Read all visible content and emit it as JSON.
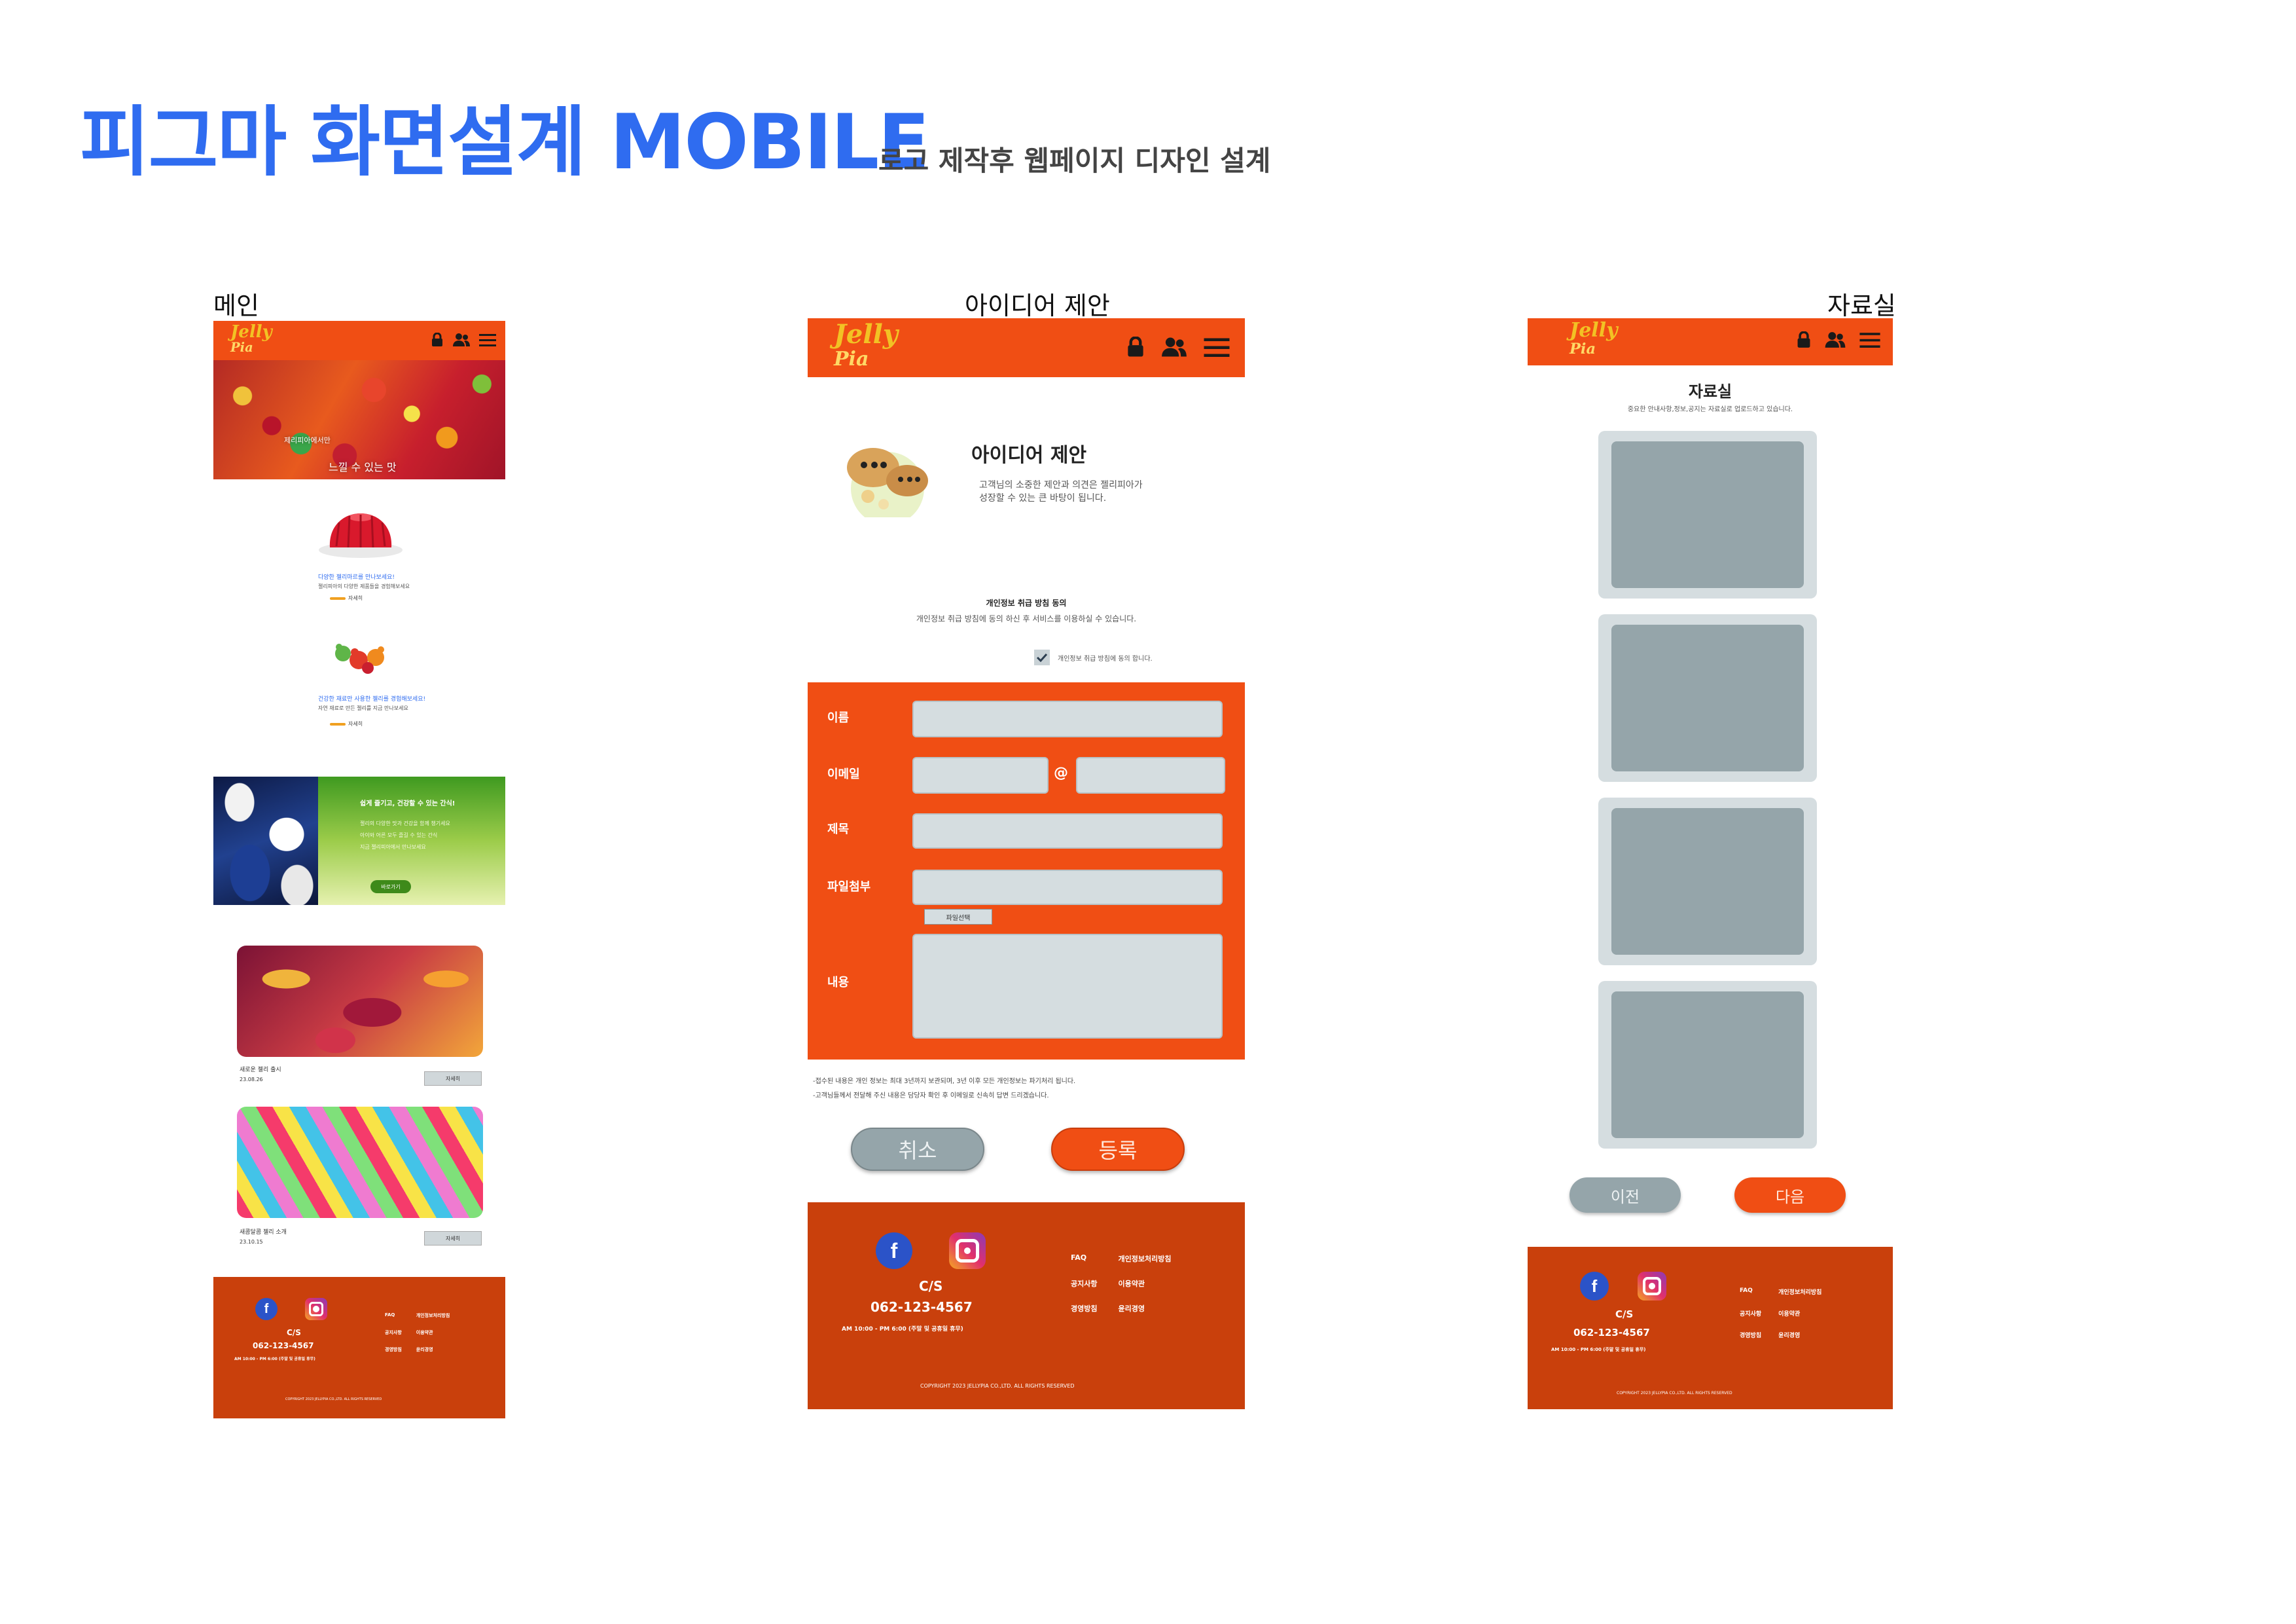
{
  "page": {
    "title": "피그마 화면설계 MOBILE",
    "subtitle": "로고 제작후 웹페이지 디자인 설계",
    "colors": {
      "title_blue": "#2f6cf0",
      "brand_orange": "#f04e14",
      "footer_orange": "#c9400c",
      "placeholder_gray": "#95a5aa"
    }
  },
  "brand": {
    "logo_line1": "Jelly",
    "logo_line2": "Pia"
  },
  "screens": {
    "main": {
      "label": "메인",
      "hero_line1": "제리피아에서만",
      "hero_line2": "느낄 수 있는 맛",
      "item1_title": "다양한 젤리마르를 만나보세요!",
      "item1_desc": "젤리피아의 다양한 제품들을 경험해보세요",
      "item2_title": "건강한 재료만 사용한 젤리를 경험해보세요!",
      "item2_desc": "자연 재료로 만든 젤리를 지금 만나보세요",
      "more": "자세히",
      "promo_title": "쉽게 즐기고, 건강할 수 있는 간식!",
      "promo_desc1": "젤리의 다양한 맛과 건강을 함께 챙기세요",
      "promo_desc2": "아이와 어른 모두 즐길 수 있는 간식",
      "promo_desc3": "지금 젤리피아에서 만나보세요",
      "promo_btn": "바로가기",
      "card1_caption": "새로운 젤리 출시",
      "card1_date": "23.08.26",
      "card2_caption": "새콤달콤 젤리 소개",
      "card2_date": "23.10.15",
      "card_btn": "자세히"
    },
    "idea": {
      "label": "아이디어 제안",
      "heading": "아이디어 제안",
      "desc1": "고객님의 소중한 제안과 의견은 젤리피아가",
      "desc2": "성장할 수 있는 큰 바탕이 됩니다.",
      "privacy_title": "개인정보 취급 방침 동의",
      "privacy_desc": "개인정보 취급 방침에 동의 하신 후 서비스를 이용하실 수 있습니다.",
      "privacy_check": "개인정보 취급 방침에 동의 합니다.",
      "fields": {
        "name": "이름",
        "email": "이메일",
        "email_at": "@",
        "subject": "제목",
        "file": "파일첨부",
        "file_btn": "파일선택",
        "content": "내용"
      },
      "note1": "-접수된 내용은 개인 정보는 최대 3년까지 보관되며, 3년 이후 모든 개인정보는 파기처리 됩니다.",
      "note2": "-고객님들께서 전달해 주신 내용은 담당자 확인 후 이메일로 신속히 답변 드리겠습니다.",
      "cancel": "취소",
      "submit": "등록"
    },
    "archive": {
      "label": "자료실",
      "heading": "자료실",
      "desc": "중요한 안내사항,정보,공지는 자료실로 업로드하고 있습니다.",
      "prev": "이전",
      "next": "다음"
    }
  },
  "footer": {
    "cs": "C/S",
    "phone": "062-123-4567",
    "hours": "AM 10:00 - PM 6:00 (주말 및 공휴일 휴무)",
    "links": [
      "FAQ",
      "개인정보처리방침",
      "공지사항",
      "이용약관",
      "경영방침",
      "윤리경영"
    ],
    "copyright": "COPYRIGHT 2023 JELLYPIA CO.,LTD. ALL RIGHTS RESERVED"
  },
  "icons": [
    "facebook-icon",
    "instagram-icon",
    "lock-icon",
    "user-icon",
    "menu-icon",
    "check-icon"
  ]
}
